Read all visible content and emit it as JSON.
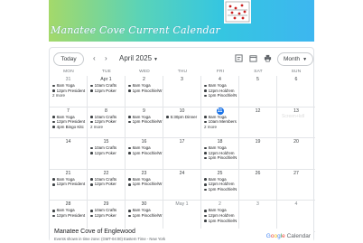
{
  "banner": {
    "title": "Manatee Cove Current Calendar"
  },
  "toolbar": {
    "today_label": "Today",
    "prev_label": "‹",
    "next_label": "›",
    "month_label": "April 2025",
    "view_label": "Month",
    "icons": [
      "event-list-icon",
      "calendar-icon",
      "print-icon"
    ]
  },
  "weekdays": [
    "MON",
    "TUE",
    "WED",
    "THU",
    "FRI",
    "SAT",
    "SUN"
  ],
  "weeks": [
    [
      {
        "date": "31",
        "other": true,
        "events": [
          "8am Yoga",
          "12pm President"
        ],
        "more": "2 more"
      },
      {
        "date": "Apr 1",
        "events": [
          "10am Crafts",
          "12pm Poker"
        ]
      },
      {
        "date": "2",
        "events": [
          "8am Yoga",
          "1pm Pinochle/W"
        ]
      },
      {
        "date": "3",
        "events": []
      },
      {
        "date": "4",
        "events": [
          "8am Yoga",
          "12pm Hold'em",
          "1pm Pinochle/N"
        ]
      },
      {
        "date": "5",
        "events": []
      },
      {
        "date": "6",
        "events": []
      }
    ],
    [
      {
        "date": "7",
        "events": [
          "8am Yoga",
          "12pm President",
          "4pm Bingo Kitc"
        ]
      },
      {
        "date": "8",
        "events": [
          "10am Crafts",
          "12pm Poker"
        ],
        "more": "2 more"
      },
      {
        "date": "9",
        "events": [
          "8am Yoga",
          "1pm Pinochle/W"
        ]
      },
      {
        "date": "10",
        "events": [
          "5:30pm Dinner"
        ]
      },
      {
        "date": "11",
        "today": true,
        "events": [
          "8am Yoga",
          "10am Members"
        ],
        "more": "2 more"
      },
      {
        "date": "12",
        "events": []
      },
      {
        "date": "13",
        "events": []
      }
    ],
    [
      {
        "date": "14",
        "events": []
      },
      {
        "date": "15",
        "events": [
          "10am Crafts",
          "12pm Poker"
        ]
      },
      {
        "date": "16",
        "events": [
          "8am Yoga",
          "1pm Pinochle/W"
        ]
      },
      {
        "date": "17",
        "events": []
      },
      {
        "date": "18",
        "events": [
          "8am Yoga",
          "12pm Hold'em",
          "1pm Pinochle/N"
        ]
      },
      {
        "date": "19",
        "events": []
      },
      {
        "date": "20",
        "events": []
      }
    ],
    [
      {
        "date": "21",
        "events": [
          "8am Yoga",
          "12pm President"
        ]
      },
      {
        "date": "22",
        "events": [
          "10am Crafts",
          "12pm Poker"
        ]
      },
      {
        "date": "23",
        "events": [
          "8am Yoga",
          "1pm Pinochle/W"
        ]
      },
      {
        "date": "24",
        "events": []
      },
      {
        "date": "25",
        "events": [
          "8am Yoga",
          "12pm Hold'em",
          "1pm Pinochle/N"
        ]
      },
      {
        "date": "26",
        "events": []
      },
      {
        "date": "27",
        "events": []
      }
    ],
    [
      {
        "date": "28",
        "events": [
          "8am Yoga",
          "12pm President"
        ]
      },
      {
        "date": "29",
        "events": [
          "10am Crafts",
          "12pm Poker"
        ]
      },
      {
        "date": "30",
        "events": [
          "8am Yoga",
          "1pm Pinochle/W"
        ]
      },
      {
        "date": "May 1",
        "other": true,
        "events": []
      },
      {
        "date": "2",
        "other": true,
        "events": [
          "8am Yoga",
          "12pm Hold'em",
          "1pm Pinochle/N"
        ]
      },
      {
        "date": "3",
        "other": true,
        "events": []
      },
      {
        "date": "4",
        "other": true,
        "events": []
      }
    ]
  ],
  "footer": {
    "org": "Manatee Cove of Englewood",
    "timezone": "Events shown in time zone: (GMT-04:00) Eastern Time - New York",
    "brand_google": [
      "G",
      "o",
      "o",
      "g",
      "l",
      "e"
    ],
    "brand_suffix": "Calendar"
  },
  "watermark": "Screen+kdl"
}
